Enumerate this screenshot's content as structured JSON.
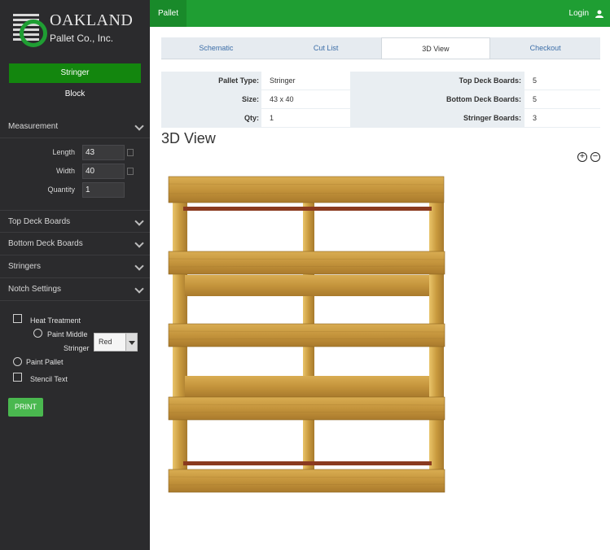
{
  "topbar": {
    "active_tab": "Pallet",
    "login": "Login"
  },
  "logo": {
    "name": "OAKLAND",
    "sub": "Pallet Co., Inc."
  },
  "sidebar": {
    "type_buttons": {
      "stringer": "Stringer",
      "block": "Block"
    },
    "sections": {
      "measurement": "Measurement",
      "top_deck": "Top Deck Boards",
      "bottom_deck": "Bottom Deck Boards",
      "stringers": "Stringers",
      "notch": "Notch Settings"
    },
    "measurement": {
      "length_label": "Length",
      "length_value": "43",
      "width_label": "Width",
      "width_value": "40",
      "quantity_label": "Quantity",
      "quantity_value": "1"
    },
    "options": {
      "heat_treatment": "Heat Treatment",
      "paint_middle": "Paint Middle",
      "stringer": "Stringer",
      "paint_color": "Red",
      "paint_pallet": "Paint Pallet",
      "stencil_text": "Stencil Text"
    },
    "print_label": "PRINT"
  },
  "tabs": [
    "Schematic",
    "Cut List",
    "3D View",
    "Checkout"
  ],
  "active_tab_index": 2,
  "info": {
    "pallet_type_label": "Pallet Type:",
    "pallet_type": "Stringer",
    "size_label": "Size:",
    "size": "43 x 40",
    "qty_label": "Qty:",
    "qty": "1",
    "top_deck_label": "Top Deck Boards:",
    "top_deck": "5",
    "bottom_deck_label": "Bottom Deck Boards:",
    "bottom_deck": "5",
    "stringer_label": "Stringer Boards:",
    "stringer": "3"
  },
  "view_title": "3D View",
  "colors": {
    "brand_green": "#1f9e33",
    "sidebar_bg": "#2b2b2d",
    "wood": "#c99a3e"
  }
}
